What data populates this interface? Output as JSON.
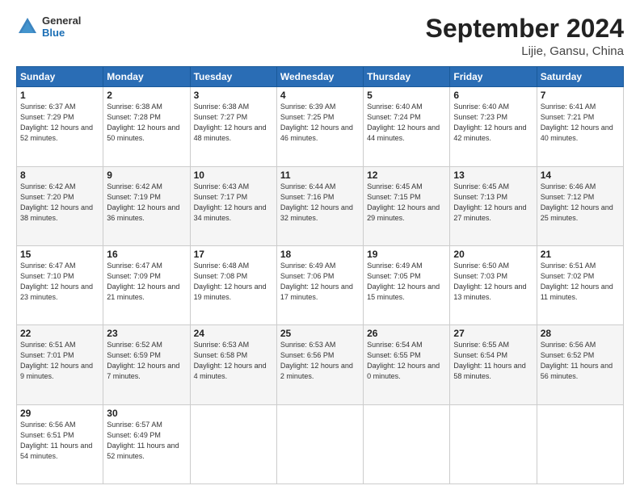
{
  "header": {
    "logo_general": "General",
    "logo_blue": "Blue",
    "month_title": "September 2024",
    "location": "Lijie, Gansu, China"
  },
  "weekdays": [
    "Sunday",
    "Monday",
    "Tuesday",
    "Wednesday",
    "Thursday",
    "Friday",
    "Saturday"
  ],
  "weeks": [
    [
      {
        "day": "1",
        "sunrise": "6:37 AM",
        "sunset": "7:29 PM",
        "daylight": "12 hours and 52 minutes."
      },
      {
        "day": "2",
        "sunrise": "6:38 AM",
        "sunset": "7:28 PM",
        "daylight": "12 hours and 50 minutes."
      },
      {
        "day": "3",
        "sunrise": "6:38 AM",
        "sunset": "7:27 PM",
        "daylight": "12 hours and 48 minutes."
      },
      {
        "day": "4",
        "sunrise": "6:39 AM",
        "sunset": "7:25 PM",
        "daylight": "12 hours and 46 minutes."
      },
      {
        "day": "5",
        "sunrise": "6:40 AM",
        "sunset": "7:24 PM",
        "daylight": "12 hours and 44 minutes."
      },
      {
        "day": "6",
        "sunrise": "6:40 AM",
        "sunset": "7:23 PM",
        "daylight": "12 hours and 42 minutes."
      },
      {
        "day": "7",
        "sunrise": "6:41 AM",
        "sunset": "7:21 PM",
        "daylight": "12 hours and 40 minutes."
      }
    ],
    [
      {
        "day": "8",
        "sunrise": "6:42 AM",
        "sunset": "7:20 PM",
        "daylight": "12 hours and 38 minutes."
      },
      {
        "day": "9",
        "sunrise": "6:42 AM",
        "sunset": "7:19 PM",
        "daylight": "12 hours and 36 minutes."
      },
      {
        "day": "10",
        "sunrise": "6:43 AM",
        "sunset": "7:17 PM",
        "daylight": "12 hours and 34 minutes."
      },
      {
        "day": "11",
        "sunrise": "6:44 AM",
        "sunset": "7:16 PM",
        "daylight": "12 hours and 32 minutes."
      },
      {
        "day": "12",
        "sunrise": "6:45 AM",
        "sunset": "7:15 PM",
        "daylight": "12 hours and 29 minutes."
      },
      {
        "day": "13",
        "sunrise": "6:45 AM",
        "sunset": "7:13 PM",
        "daylight": "12 hours and 27 minutes."
      },
      {
        "day": "14",
        "sunrise": "6:46 AM",
        "sunset": "7:12 PM",
        "daylight": "12 hours and 25 minutes."
      }
    ],
    [
      {
        "day": "15",
        "sunrise": "6:47 AM",
        "sunset": "7:10 PM",
        "daylight": "12 hours and 23 minutes."
      },
      {
        "day": "16",
        "sunrise": "6:47 AM",
        "sunset": "7:09 PM",
        "daylight": "12 hours and 21 minutes."
      },
      {
        "day": "17",
        "sunrise": "6:48 AM",
        "sunset": "7:08 PM",
        "daylight": "12 hours and 19 minutes."
      },
      {
        "day": "18",
        "sunrise": "6:49 AM",
        "sunset": "7:06 PM",
        "daylight": "12 hours and 17 minutes."
      },
      {
        "day": "19",
        "sunrise": "6:49 AM",
        "sunset": "7:05 PM",
        "daylight": "12 hours and 15 minutes."
      },
      {
        "day": "20",
        "sunrise": "6:50 AM",
        "sunset": "7:03 PM",
        "daylight": "12 hours and 13 minutes."
      },
      {
        "day": "21",
        "sunrise": "6:51 AM",
        "sunset": "7:02 PM",
        "daylight": "12 hours and 11 minutes."
      }
    ],
    [
      {
        "day": "22",
        "sunrise": "6:51 AM",
        "sunset": "7:01 PM",
        "daylight": "12 hours and 9 minutes."
      },
      {
        "day": "23",
        "sunrise": "6:52 AM",
        "sunset": "6:59 PM",
        "daylight": "12 hours and 7 minutes."
      },
      {
        "day": "24",
        "sunrise": "6:53 AM",
        "sunset": "6:58 PM",
        "daylight": "12 hours and 4 minutes."
      },
      {
        "day": "25",
        "sunrise": "6:53 AM",
        "sunset": "6:56 PM",
        "daylight": "12 hours and 2 minutes."
      },
      {
        "day": "26",
        "sunrise": "6:54 AM",
        "sunset": "6:55 PM",
        "daylight": "12 hours and 0 minutes."
      },
      {
        "day": "27",
        "sunrise": "6:55 AM",
        "sunset": "6:54 PM",
        "daylight": "11 hours and 58 minutes."
      },
      {
        "day": "28",
        "sunrise": "6:56 AM",
        "sunset": "6:52 PM",
        "daylight": "11 hours and 56 minutes."
      }
    ],
    [
      {
        "day": "29",
        "sunrise": "6:56 AM",
        "sunset": "6:51 PM",
        "daylight": "11 hours and 54 minutes."
      },
      {
        "day": "30",
        "sunrise": "6:57 AM",
        "sunset": "6:49 PM",
        "daylight": "11 hours and 52 minutes."
      },
      null,
      null,
      null,
      null,
      null
    ]
  ],
  "labels": {
    "sunrise": "Sunrise:",
    "sunset": "Sunset:",
    "daylight": "Daylight:"
  }
}
